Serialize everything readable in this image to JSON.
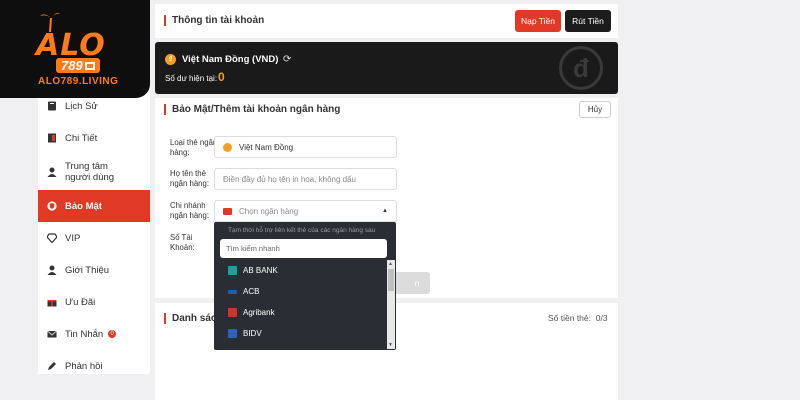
{
  "logo": {
    "brand": "ALO",
    "number": "789",
    "domain": "ALO789.LIVING"
  },
  "sidebar": {
    "items": [
      {
        "label": "Lịch Sử",
        "icon": "history-icon"
      },
      {
        "label": "Chi Tiết",
        "icon": "receipt-icon"
      },
      {
        "label": "Trung tâm người dùng",
        "icon": "user-icon"
      },
      {
        "label": "Bảo Mật",
        "icon": "shield-icon",
        "active": true
      },
      {
        "label": "VIP",
        "icon": "diamond-icon"
      },
      {
        "label": "Giới Thiệu",
        "icon": "referral-icon"
      },
      {
        "label": "Ưu Đãi",
        "icon": "gift-icon"
      },
      {
        "label": "Tin Nhắn",
        "icon": "mail-icon",
        "badge": "0"
      },
      {
        "label": "Phản hồi",
        "icon": "pen-icon"
      }
    ]
  },
  "header": {
    "title": "Thông tin tài khoản",
    "deposit_label": "Nạp Tiền",
    "withdraw_label": "Rút Tiền"
  },
  "balance": {
    "currency": "Việt Nam Đồng  (VND)",
    "label": "Số dư hiện tại:",
    "amount": "0",
    "coin_symbol": "₫",
    "watermark": "đ"
  },
  "bank_form": {
    "title": "Bảo Mật/Thêm tài khoản ngân hàng",
    "cancel_label": "Hủy",
    "card_type_label": "Loại thẻ ngân hàng:",
    "card_type_value": "Việt Nam Đồng",
    "name_label": "Họ tên thẻ ngân hàng:",
    "name_placeholder": "Điền đầy đủ họ tên in hoa, không dấu",
    "branch_label": "Chi nhánh ngân hàng:",
    "branch_placeholder": "Chọn ngân hàng",
    "account_label": "Số Tài Khoản:",
    "submit_label": "n"
  },
  "dropdown": {
    "note": "Tạm thời hỗ trợ liên kết thẻ của các ngân hàng sau",
    "search_placeholder": "Tìm kiếm nhanh",
    "options": [
      {
        "label": "AB BANK",
        "color": "#1aa39a"
      },
      {
        "label": "ACB",
        "color": "#1d5fb3"
      },
      {
        "label": "Agribank",
        "color": "#c23a2e"
      },
      {
        "label": "BIDV",
        "color": "#2a64b8"
      }
    ]
  },
  "card_list": {
    "title": "Danh sách",
    "count_label": "Số tiền thẻ:",
    "count_value": "0/3"
  },
  "colors": {
    "accent": "#e03a26",
    "gold": "#f2a024",
    "dark": "#1a1a1a"
  }
}
